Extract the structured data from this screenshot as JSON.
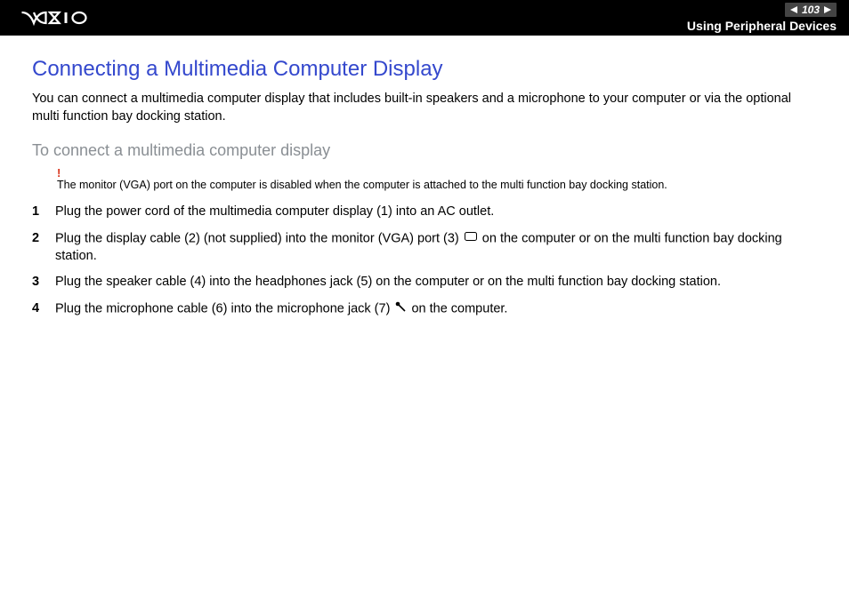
{
  "header": {
    "page_number": "103",
    "section": "Using Peripheral Devices"
  },
  "title": "Connecting a Multimedia Computer Display",
  "intro": "You can connect a multimedia computer display that includes built-in speakers and a microphone to your computer or via the optional multi function bay docking station.",
  "subtitle": "To connect a multimedia computer display",
  "note": {
    "bang": "!",
    "text": "The monitor (VGA) port on the computer is disabled when the computer is attached to the multi function bay docking station."
  },
  "steps": [
    {
      "num": "1",
      "text": "Plug the power cord of the multimedia computer display (1) into an AC outlet."
    },
    {
      "num": "2",
      "text_a": "Plug the display cable (2) (not supplied) into the monitor (VGA) port (3) ",
      "text_b": " on the computer or on the multi function bay docking station."
    },
    {
      "num": "3",
      "text": "Plug the speaker cable (4) into the headphones jack (5) on the computer or on the multi function bay docking station."
    },
    {
      "num": "4",
      "text_a": "Plug the microphone cable (6) into the microphone jack (7) ",
      "text_b": " on the computer."
    }
  ]
}
